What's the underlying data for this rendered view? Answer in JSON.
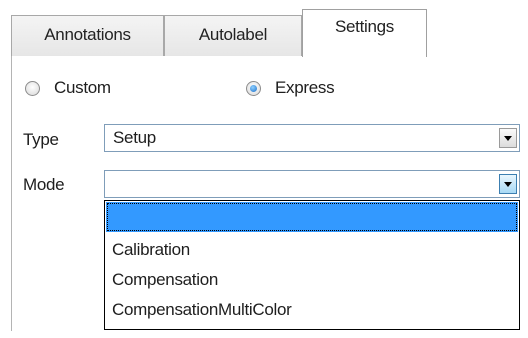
{
  "tabs": [
    {
      "label": "Annotations",
      "active": false
    },
    {
      "label": "Autolabel",
      "active": false
    },
    {
      "label": "Settings",
      "active": true
    }
  ],
  "mode_radio": {
    "custom_label": "Custom",
    "express_label": "Express",
    "selected": "Express"
  },
  "type_field": {
    "label": "Type",
    "value": "Setup"
  },
  "mode_field": {
    "label": "Mode",
    "value": "",
    "options": [
      "",
      "Calibration",
      "Compensation",
      "CompensationMultiColor"
    ],
    "highlighted_index": 0
  },
  "icons": {
    "dropdown_arrow": "chevron-down-icon",
    "radio": "radio-button-icon"
  },
  "colors": {
    "selection": "#3399ff",
    "combo_border": "#7f9db9"
  }
}
